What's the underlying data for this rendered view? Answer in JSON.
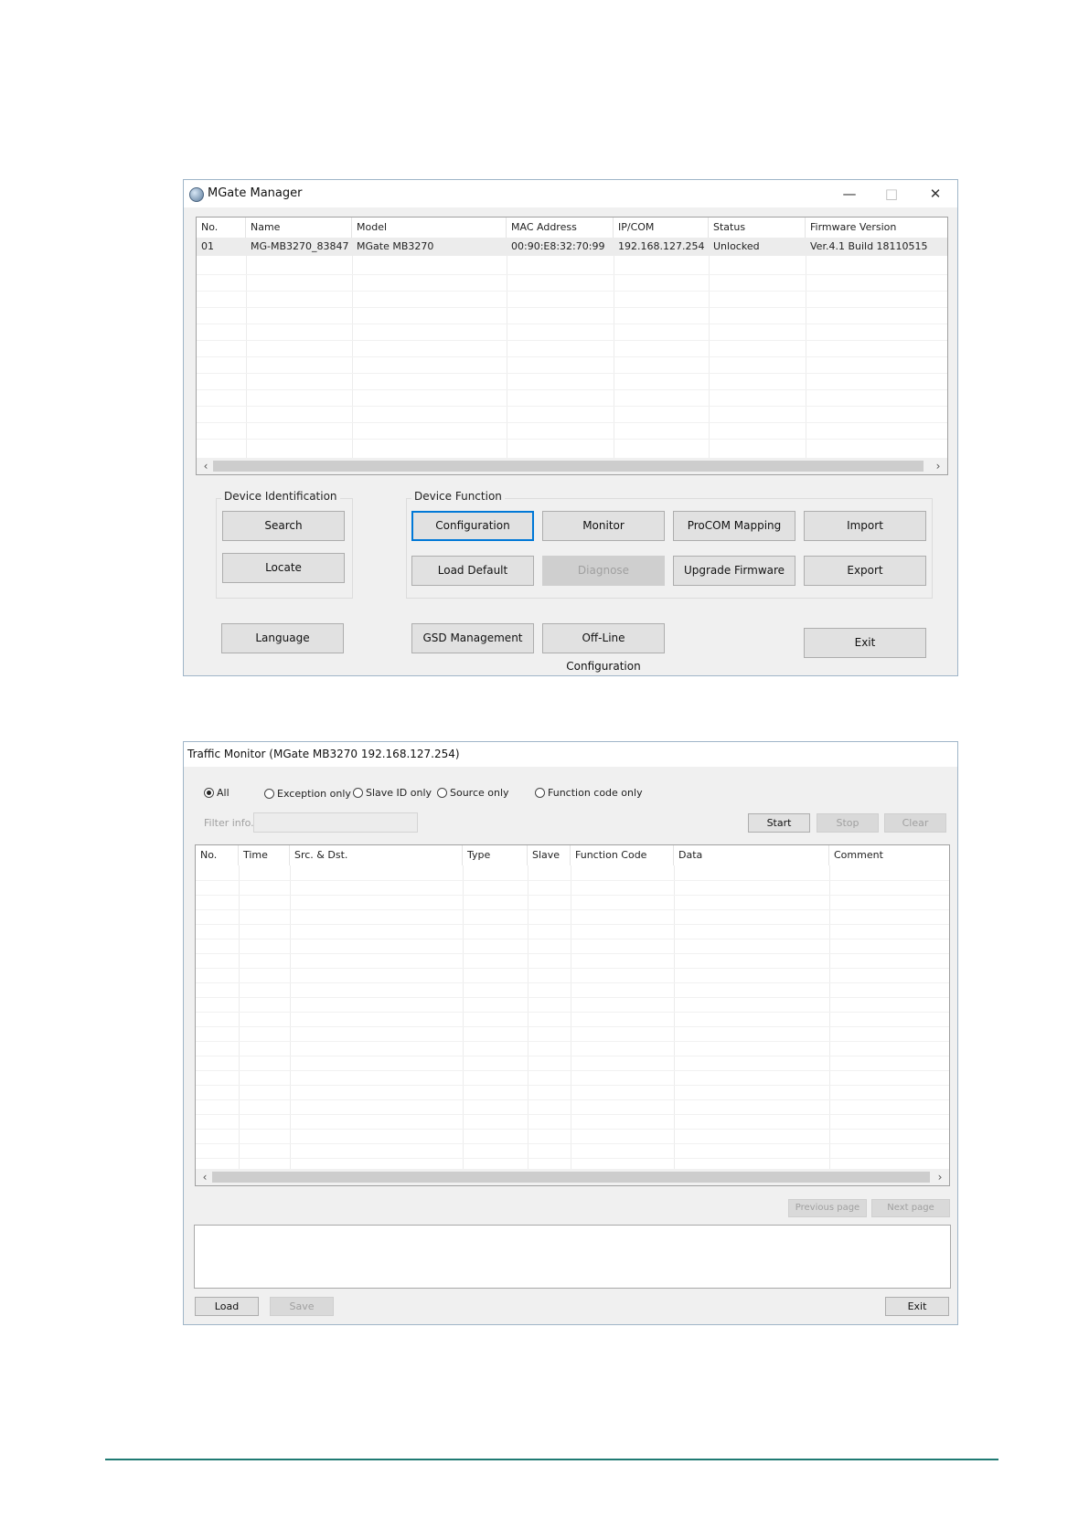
{
  "mgate": {
    "title": "MGate Manager",
    "window_controls": {
      "minimize": "—",
      "maximize": "□",
      "close": "✕"
    },
    "columns": [
      "No.",
      "Name",
      "Model",
      "MAC Address",
      "IP/COM",
      "Status",
      "Firmware Version"
    ],
    "rows": [
      [
        "01",
        "MG-MB3270_83847",
        "MGate MB3270",
        "00:90:E8:32:70:99",
        "192.168.127.254",
        "Unlocked",
        "Ver.4.1 Build 18110515"
      ]
    ],
    "scroll_left": "‹",
    "scroll_right": "›",
    "device_identification": {
      "label": "Device Identification",
      "search": "Search",
      "locate": "Locate"
    },
    "device_function": {
      "label": "Device Function",
      "configuration": "Configuration",
      "monitor": "Monitor",
      "procom_mapping": "ProCOM Mapping",
      "import": "Import",
      "load_default": "Load Default",
      "diagnose": "Diagnose",
      "upgrade_firmware": "Upgrade Firmware",
      "export": "Export"
    },
    "language": "Language",
    "gsd_management": "GSD Management",
    "offline_configuration": "Off-Line Configuration",
    "exit": "Exit"
  },
  "traffic": {
    "title": "Traffic Monitor (MGate MB3270 192.168.127.254)",
    "filters": [
      "All",
      "Exception only",
      "Slave ID only",
      "Source only",
      "Function code only"
    ],
    "selected_filter": "All",
    "filter_info_label": "Filter info.",
    "filter_info_value": "",
    "start": "Start",
    "stop": "Stop",
    "clear": "Clear",
    "columns": [
      "No.",
      "Time",
      "Src. & Dst.",
      "Type",
      "Slave",
      "Function Code",
      "Data",
      "Comment"
    ],
    "scroll_left": "‹",
    "scroll_right": "›",
    "previous_page": "Previous page",
    "next_page": "Next page",
    "detail_text": "",
    "load": "Load",
    "save": "Save",
    "exit": "Exit"
  }
}
